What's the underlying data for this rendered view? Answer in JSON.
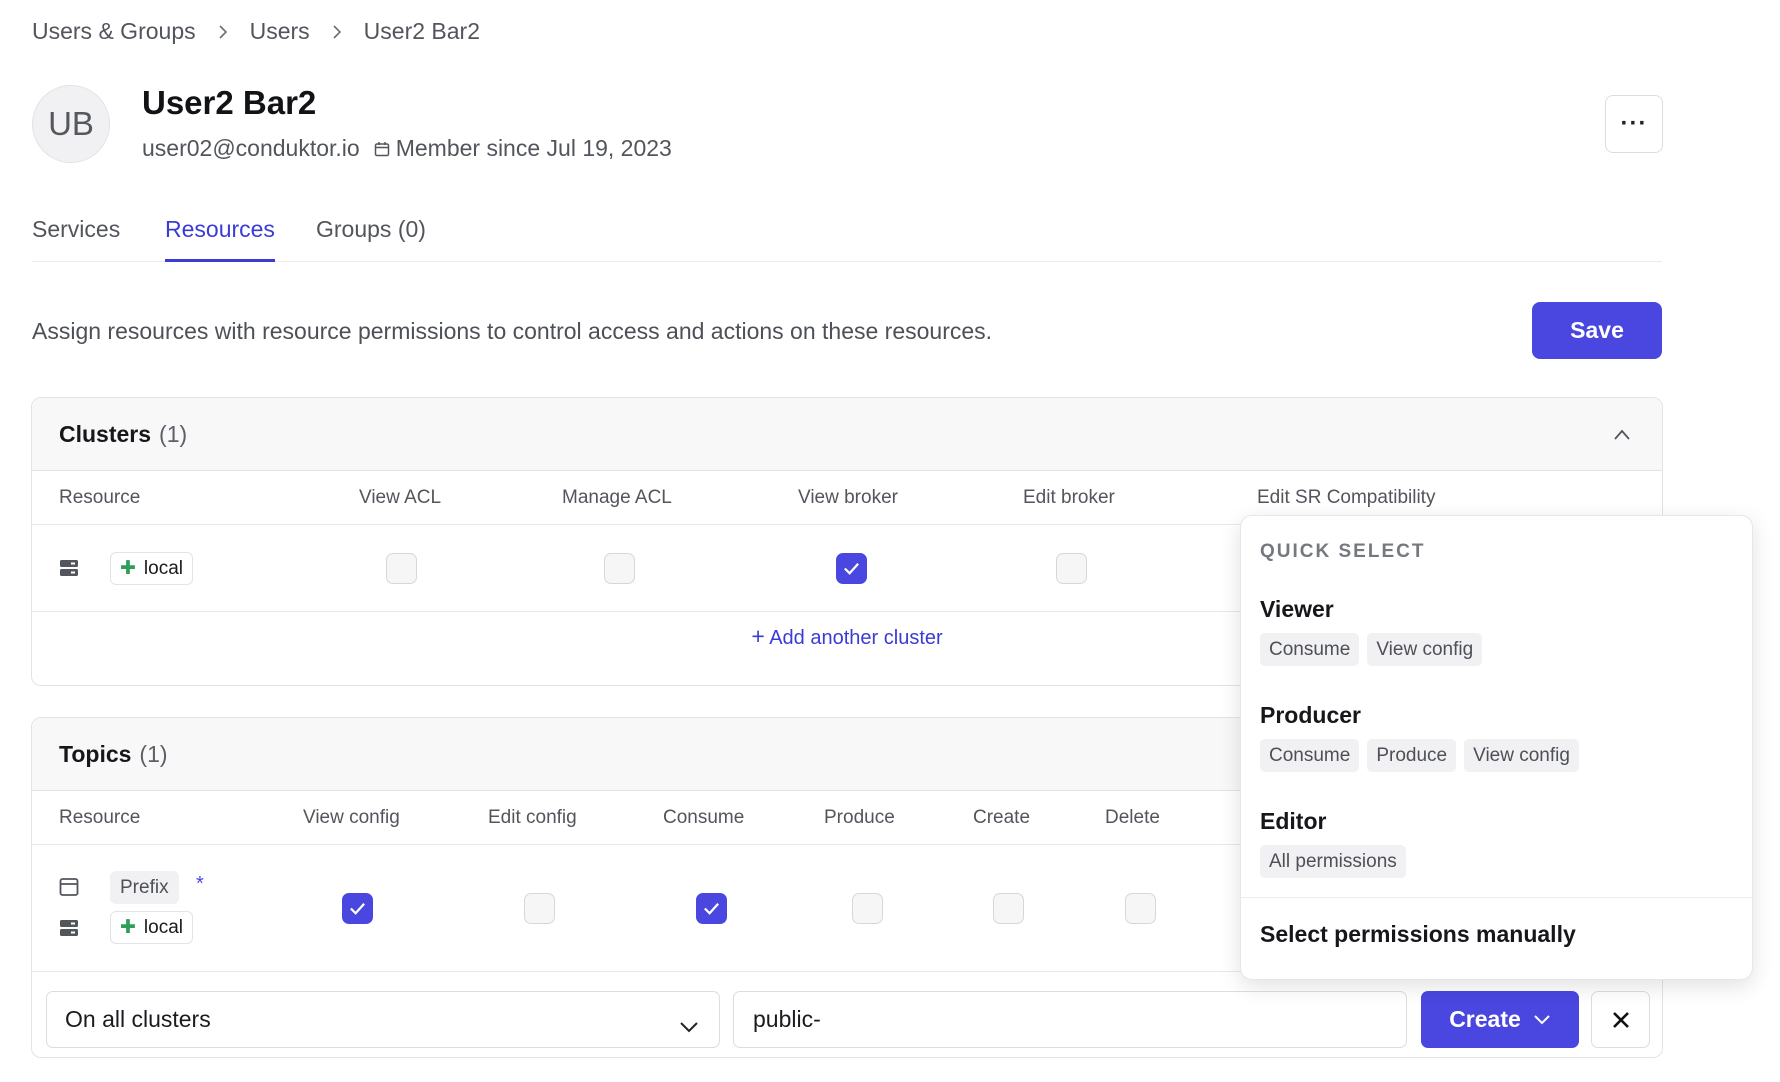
{
  "breadcrumb": [
    "Users & Groups",
    "Users",
    "User2 Bar2"
  ],
  "user": {
    "initials": "UB",
    "name": "User2 Bar2",
    "email": "user02@conduktor.io",
    "member_since": "Member since Jul 19, 2023"
  },
  "header": {
    "more_label": "···"
  },
  "tabs": [
    {
      "label": "Services",
      "active": false
    },
    {
      "label": "Resources",
      "active": true
    },
    {
      "label": "Groups (0)",
      "active": false
    }
  ],
  "description": "Assign resources with resource permissions to control access and actions on these resources.",
  "save_label": "Save",
  "clusters": {
    "title": "Clusters",
    "count": "(1)",
    "columns": [
      "Resource",
      "View ACL",
      "Manage ACL",
      "View broker",
      "Edit broker",
      "Edit SR Compatibility"
    ],
    "rows": [
      {
        "resource": "local",
        "permissions": [
          false,
          false,
          true,
          false
        ]
      }
    ],
    "add_label": "Add another cluster"
  },
  "topics": {
    "title": "Topics",
    "count": "(1)",
    "columns": [
      "Resource",
      "View config",
      "Edit config",
      "Consume",
      "Produce",
      "Create",
      "Delete"
    ],
    "rows": [
      {
        "pattern": "Prefix",
        "cluster": "local",
        "permissions": [
          true,
          false,
          true,
          false,
          false,
          false
        ]
      }
    ]
  },
  "form": {
    "cluster_select": "On all clusters",
    "name_value": "public-",
    "create_label": "Create"
  },
  "quick_select": {
    "label": "QUICK SELECT",
    "groups": [
      {
        "title": "Viewer",
        "tags": [
          "Consume",
          "View config"
        ]
      },
      {
        "title": "Producer",
        "tags": [
          "Consume",
          "Produce",
          "View config"
        ]
      },
      {
        "title": "Editor",
        "tags": [
          "All permissions"
        ]
      }
    ],
    "manual_label": "Select permissions manually"
  },
  "colors": {
    "accent": "#4a47e0",
    "link": "#3b3bd6",
    "cluster_icon": "#2f9e5a"
  },
  "icons": [
    "chevron-right-icon",
    "calendar-icon",
    "more-icon",
    "chevron-up-icon",
    "server-icon",
    "cluster-plus-icon",
    "plus-icon",
    "window-icon",
    "chevron-down-icon",
    "close-icon",
    "check-icon"
  ]
}
